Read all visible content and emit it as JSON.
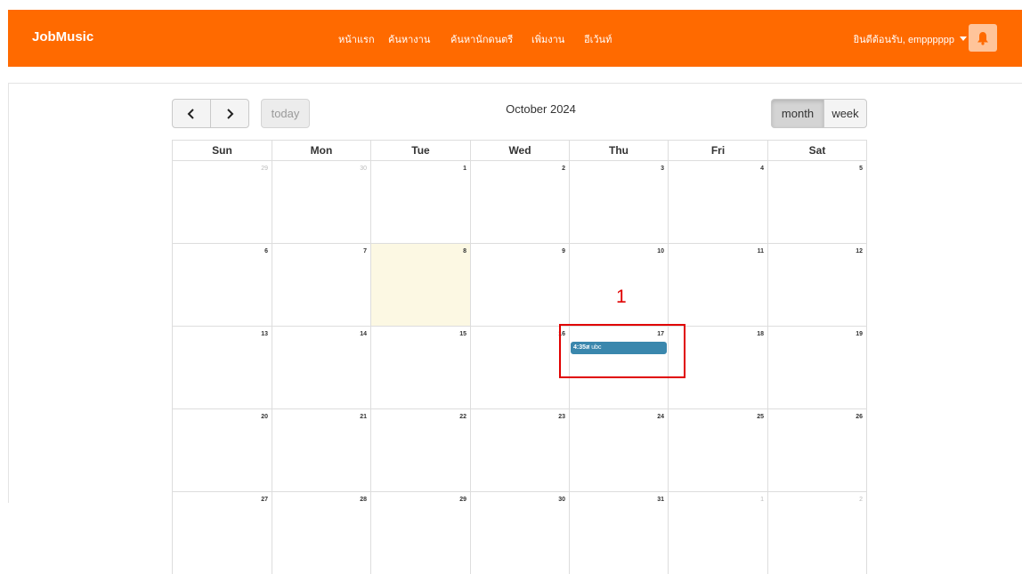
{
  "navbar": {
    "brand": "JobMusic",
    "links": [
      "หน้าแรก",
      "ค้นหางาน",
      "ค้นหานักดนตรี",
      "เพิ่มงาน",
      "อีเว้นท์"
    ],
    "user_greeting": "ยินดีต้อนรับ, empppppp",
    "bell_icon": "bell-icon",
    "color": "#ff6a00"
  },
  "calendar": {
    "prev_icon": "chevron-left-icon",
    "next_icon": "chevron-right-icon",
    "today_label": "today",
    "title": "October 2024",
    "view_month": "month",
    "view_week": "week",
    "weekdays": [
      "Sun",
      "Mon",
      "Tue",
      "Wed",
      "Thu",
      "Fri",
      "Sat"
    ],
    "weeks": [
      [
        "29",
        "30",
        "1",
        "2",
        "3",
        "4",
        "5"
      ],
      [
        "6",
        "7",
        "8",
        "9",
        "10",
        "11",
        "12"
      ],
      [
        "13",
        "14",
        "15",
        "16",
        "17",
        "18",
        "19"
      ],
      [
        "20",
        "21",
        "22",
        "23",
        "24",
        "25",
        "26"
      ],
      [
        "27",
        "28",
        "29",
        "30",
        "31",
        "1",
        "2"
      ]
    ],
    "today_day": "8",
    "event": {
      "time": "4:35ส",
      "title": "ubc",
      "color": "#3a87ad"
    }
  },
  "annotation": {
    "number": "1",
    "color": "#e00000"
  }
}
